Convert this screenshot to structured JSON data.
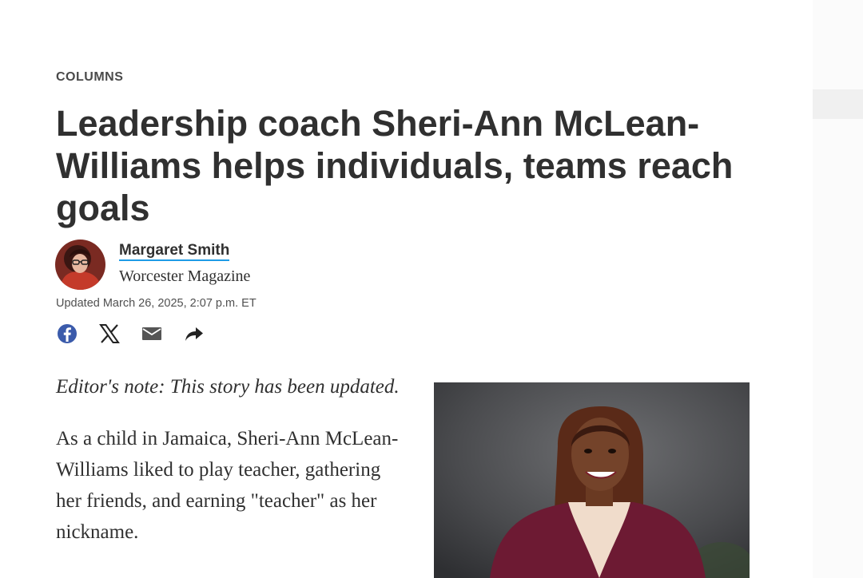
{
  "article": {
    "section": "COLUMNS",
    "headline": "Leadership coach Sheri-Ann McLean-Williams helps individuals, teams reach goals",
    "author": {
      "name": "Margaret Smith",
      "publication": "Worcester Magazine"
    },
    "updated": "Updated March 26, 2025, 2:07 p.m. ET",
    "share": [
      {
        "icon": "facebook-icon"
      },
      {
        "icon": "x-icon"
      },
      {
        "icon": "email-icon"
      },
      {
        "icon": "share-arrow-icon"
      }
    ],
    "editor_note": "Editor's note: This story has been updated.",
    "paragraph1": "As a child in Jamaica, Sheri-Ann McLean-Williams liked to play teacher, gathering her friends, and earning \"teacher\" as her nickname."
  },
  "colors": {
    "link_underline": "#1e9be6",
    "facebook": "#3b5bab",
    "text": "#303030"
  }
}
